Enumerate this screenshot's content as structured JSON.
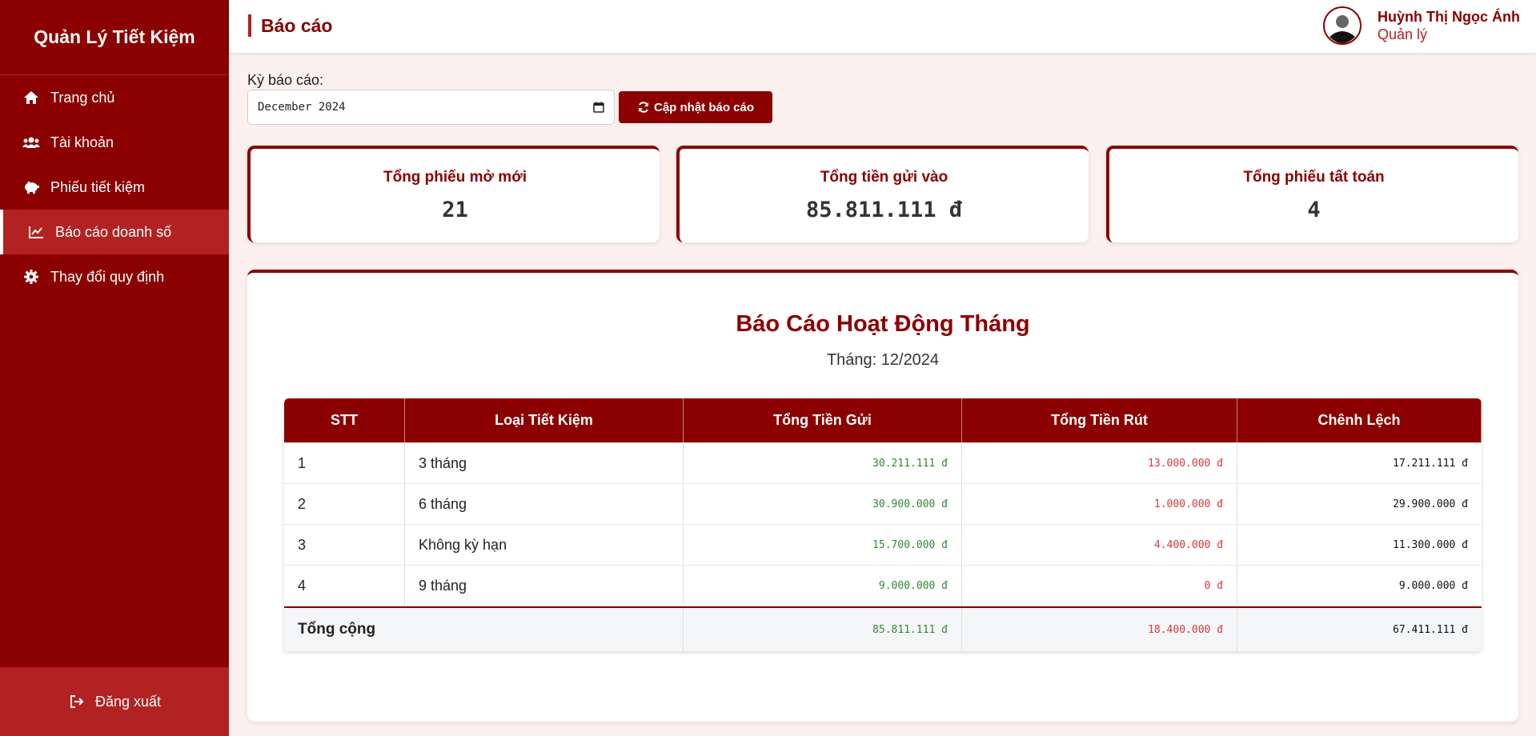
{
  "sidebar": {
    "brand": "Quản Lý Tiết Kiệm",
    "items": [
      {
        "label": "Trang chủ",
        "icon": "home-icon"
      },
      {
        "label": "Tài khoản",
        "icon": "users-icon"
      },
      {
        "label": "Phiếu tiết kiệm",
        "icon": "piggy-bank-icon"
      },
      {
        "label": "Báo cáo doanh số",
        "icon": "chart-line-icon",
        "active": true
      },
      {
        "label": "Thay đổi quy định",
        "icon": "gear-icon"
      }
    ],
    "logout": "Đăng xuất"
  },
  "header": {
    "title": "Báo cáo",
    "user_name": "Huỳnh Thị Ngọc Ánh",
    "user_role": "Quản lý"
  },
  "filter": {
    "label": "Kỳ báo cáo:",
    "value": "December 2024",
    "button": "Cập nhật báo cáo"
  },
  "stats": [
    {
      "title": "Tổng phiếu mở mới",
      "value": "21"
    },
    {
      "title": "Tổng tiền gửi vào",
      "value": "85.811.111 đ"
    },
    {
      "title": "Tổng phiếu tất toán",
      "value": "4"
    }
  ],
  "report": {
    "title": "Báo Cáo Hoạt Động Tháng",
    "subtitle": "Tháng: 12/2024",
    "columns": [
      "STT",
      "Loại Tiết Kiệm",
      "Tổng Tiền Gửi",
      "Tổng Tiền Rút",
      "Chênh Lệch"
    ],
    "rows": [
      {
        "stt": "1",
        "type": "3 tháng",
        "deposit": "30.211.111 đ",
        "withdraw": "13.000.000 đ",
        "diff": "17.211.111 đ"
      },
      {
        "stt": "2",
        "type": "6 tháng",
        "deposit": "30.900.000 đ",
        "withdraw": "1.000.000 đ",
        "diff": "29.900.000 đ"
      },
      {
        "stt": "3",
        "type": "Không kỳ hạn",
        "deposit": "15.700.000 đ",
        "withdraw": "4.400.000 đ",
        "diff": "11.300.000 đ"
      },
      {
        "stt": "4",
        "type": "9 tháng",
        "deposit": "9.000.000 đ",
        "withdraw": "0 đ",
        "diff": "9.000.000 đ"
      }
    ],
    "total": {
      "label": "Tổng cộng",
      "deposit": "85.811.111 đ",
      "withdraw": "18.400.000 đ",
      "diff": "67.411.111 đ"
    }
  },
  "colors": {
    "primary": "#8b0000",
    "accent": "#b22222",
    "positive": "#2e8b2e",
    "negative": "#d9363e"
  }
}
